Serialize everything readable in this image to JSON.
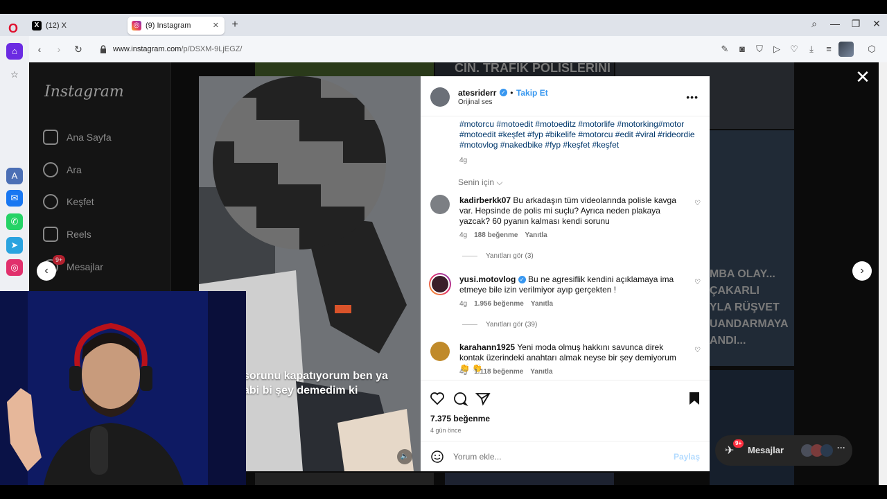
{
  "browser": {
    "tabs": [
      {
        "label": "(12) X",
        "icon": "x-logo-icon"
      },
      {
        "label": "(9) Instagram",
        "icon": "instagram-icon",
        "active": true
      }
    ],
    "url_host": "www.instagram.com",
    "url_path": "/p/DSXM-9LjEGZ/"
  },
  "sidebar": {
    "logo": "Instagram",
    "items": [
      {
        "label": "Ana Sayfa",
        "icon": "home-icon"
      },
      {
        "label": "Ara",
        "icon": "search-icon"
      },
      {
        "label": "Keşfet",
        "icon": "explore-icon"
      },
      {
        "label": "Reels",
        "icon": "reels-icon"
      },
      {
        "label": "Mesajlar",
        "icon": "messages-icon",
        "badge": "9+"
      }
    ]
  },
  "background_tiles": {
    "tile1_text": "CIN. TRAFIK POLISLERINI",
    "tile2_text": "MBA OLAY...\nÇAKARLI\nYLA RÜŞVET\nUANDARMAYA\nANDI..."
  },
  "post": {
    "media_caption": "sorunu kapatıyorum ben ya\nabi bi şey demedim ki",
    "author": "atesriderr",
    "follow_label": "Takip Et",
    "audio": "Orijinal ses",
    "hashtags": "#motorcu #motoedit #motoeditz #motorlife #motorking#motor #motoedit #keşfet #fyp #bikelife #motorcu #edit #viral #rideordie #motovlog #nakedbike #fyp #keşfet #keşfet",
    "caption_age": "4g",
    "filter_label": "Senin için",
    "comments": [
      {
        "user": "kadirberkk07",
        "text": "Bu arkadaşın tüm videolarında polisle kavga var. Hepsinde de polis mi suçlu? Ayrıca neden plakaya yazcak? 60 pyanın kalması kendi sorunu",
        "age": "4g",
        "likes": "188 beğenme",
        "reply": "Yanıtla",
        "see_replies": "Yanıtları gör (3)"
      },
      {
        "user": "yusi.motovlog",
        "verified": true,
        "text": "Bu ne agresiflik kendini açıklamaya ima etmeye bile izin verilmiyor ayıp gerçekten !",
        "age": "4g",
        "likes": "1.956 beğenme",
        "reply": "Yanıtla",
        "see_replies": "Yanıtları gör (39)"
      },
      {
        "user": "karahann1925",
        "text": "Yeni moda olmuş hakkını savunca direk kontak üzerindeki anahtarı almak neyse bir şey demiyorum 👏 👏",
        "age": "4g",
        "likes": "1.118 beğenme",
        "reply": "Yanıtla"
      }
    ],
    "likes_total": "7.375 beğenme",
    "posted": "4 gün önce",
    "comment_placeholder": "Yorum ekle...",
    "post_button": "Paylaş"
  },
  "messages_pill": {
    "label": "Mesajlar",
    "badge": "9+"
  },
  "colors": {
    "accent": "#3797ef",
    "verified": "#3897f0",
    "opera": "#e0102e"
  }
}
